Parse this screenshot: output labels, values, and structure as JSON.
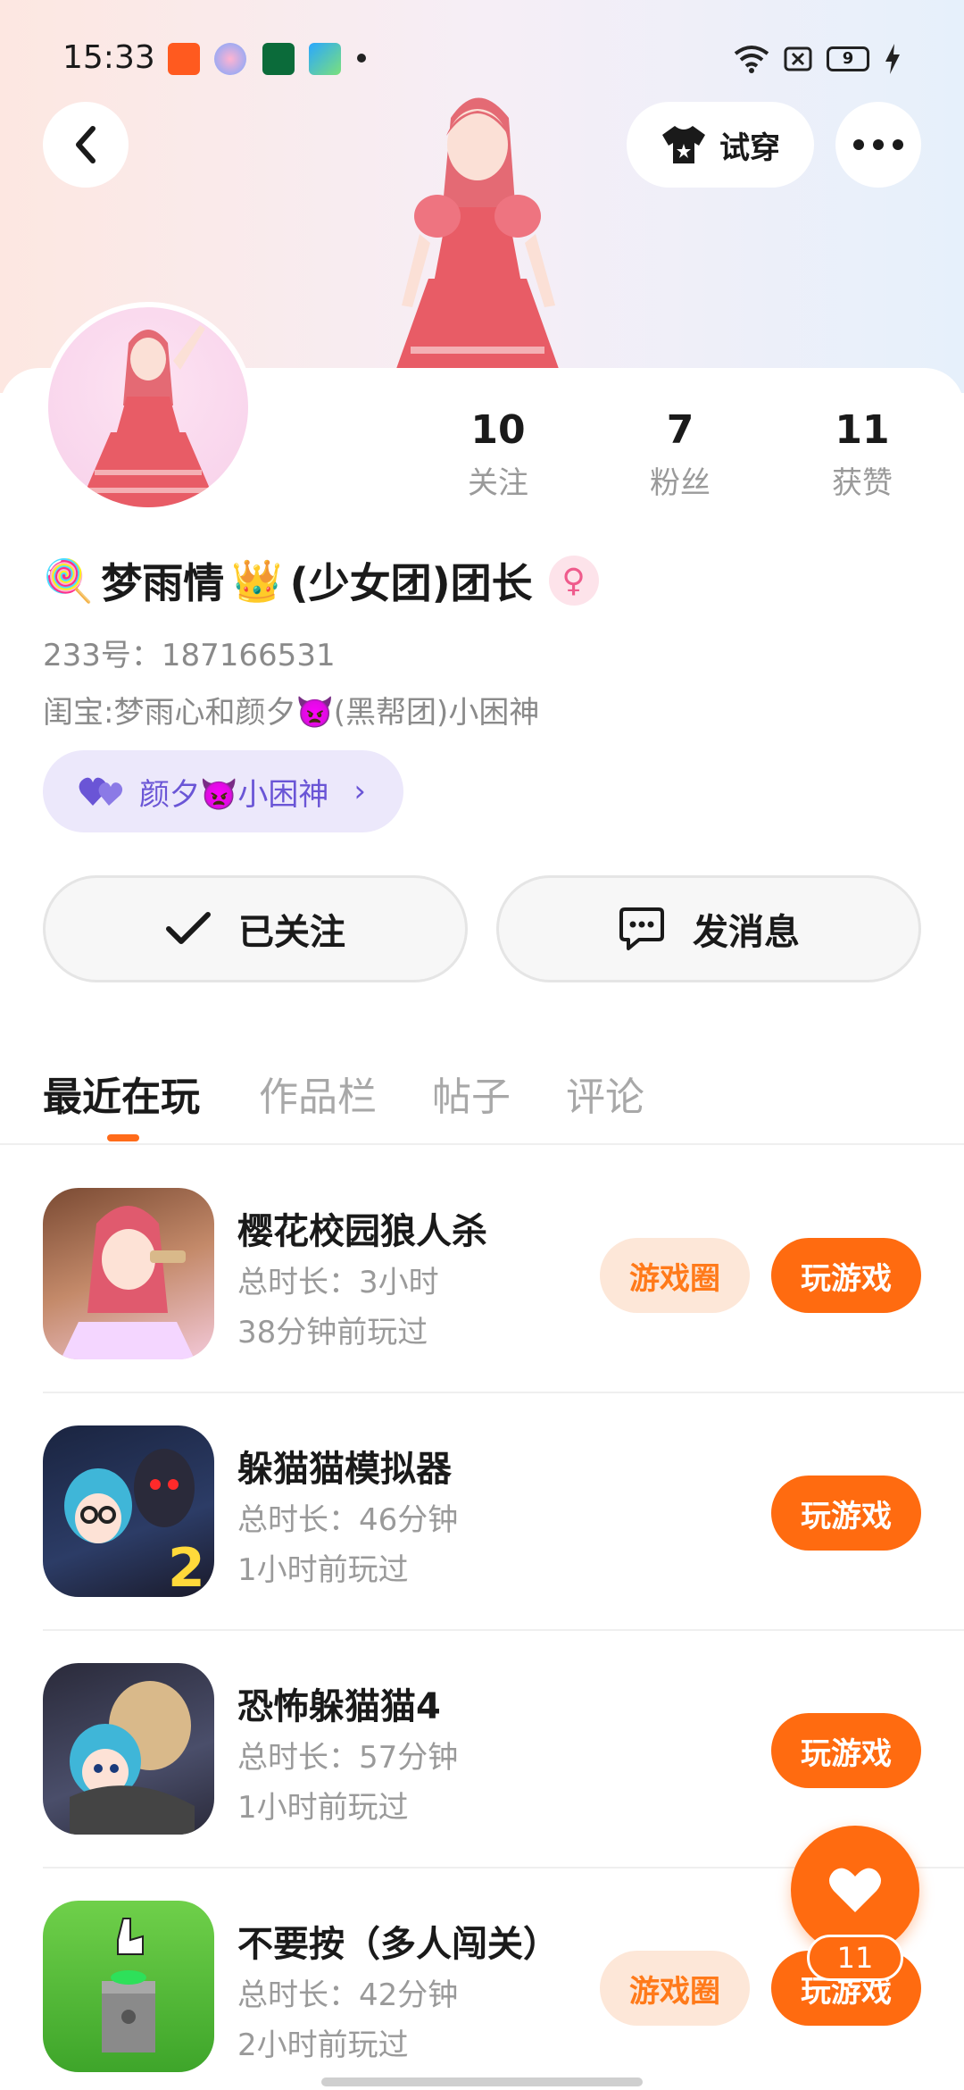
{
  "status_bar": {
    "time": "15:33",
    "battery": "9"
  },
  "header": {
    "try_on_label": "试穿"
  },
  "profile": {
    "stats": [
      {
        "value": "10",
        "label": "关注"
      },
      {
        "value": "7",
        "label": "粉丝"
      },
      {
        "value": "11",
        "label": "获赞"
      }
    ],
    "name_prefix_emoji": "🍭",
    "name_main": "梦雨情",
    "name_crown": "👑",
    "name_suffix": "(少女团)团长",
    "gender_symbol": "♀",
    "uid": "233号：187166531",
    "bio": "闺宝:梦雨心和颜夕👿(黑帮团)小困神",
    "cp_name": "颜夕👿小困神"
  },
  "actions": {
    "follow_label": "已关注",
    "message_label": "发消息"
  },
  "tabs": [
    "最近在玩",
    "作品栏",
    "帖子",
    "评论"
  ],
  "games": [
    {
      "title": "樱花校园狼人杀",
      "duration": "总时长：3小时",
      "last_played": "38分钟前玩过",
      "circle_label": "游戏圈",
      "play_label": "玩游戏"
    },
    {
      "title": "躲猫猫模拟器",
      "duration": "总时长：46分钟",
      "last_played": "1小时前玩过",
      "play_label": "玩游戏"
    },
    {
      "title": "恐怖躲猫猫4",
      "duration": "总时长：57分钟",
      "last_played": "1小时前玩过",
      "play_label": "玩游戏"
    },
    {
      "title": "不要按（多人闯关）",
      "duration": "总时长：42分钟",
      "last_played": "2小时前玩过",
      "circle_label": "游戏圈",
      "play_label": "玩游戏"
    }
  ],
  "fab": {
    "like_count": "11"
  },
  "colors": {
    "accent": "#ff6b10",
    "cp_bg": "#ece8fb",
    "cp_text": "#6a55d6"
  }
}
